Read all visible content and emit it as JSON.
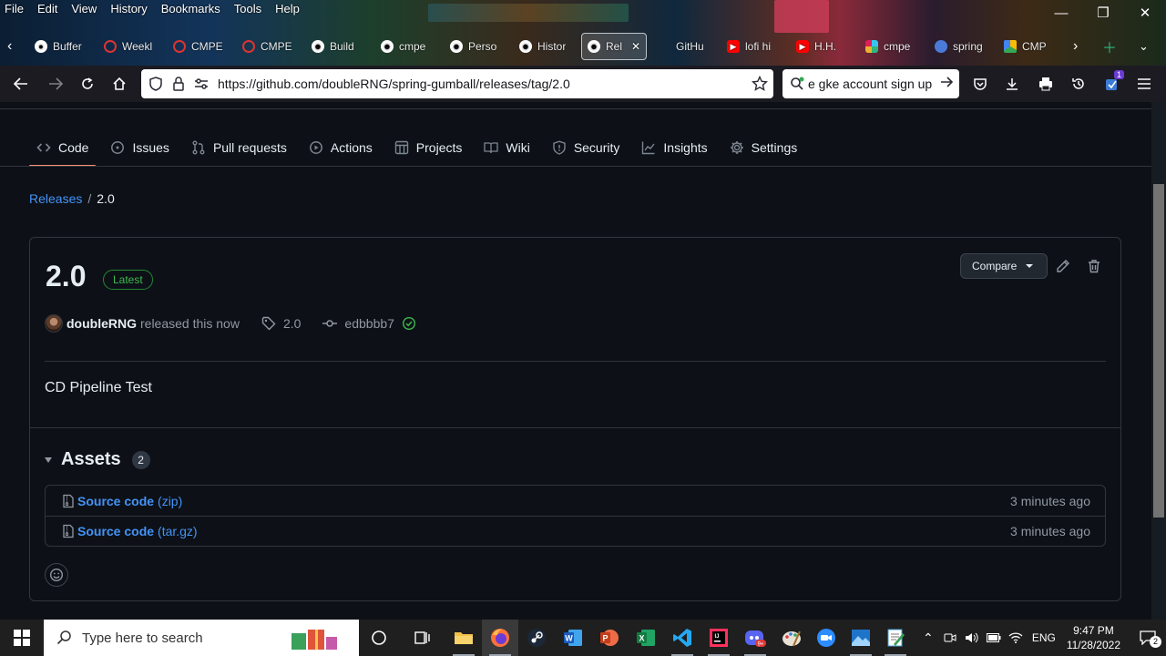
{
  "menu": [
    "File",
    "Edit",
    "View",
    "History",
    "Bookmarks",
    "Tools",
    "Help"
  ],
  "window_controls": [
    "minimize",
    "restore",
    "close"
  ],
  "tabs": [
    {
      "label": "Buffer",
      "icon": "bullet-icon"
    },
    {
      "label": "Weekl",
      "icon": "cmpe-icon"
    },
    {
      "label": "CMPE",
      "icon": "cmpe-icon"
    },
    {
      "label": "CMPE",
      "icon": "cmpe-icon"
    },
    {
      "label": "Build",
      "icon": "github-icon"
    },
    {
      "label": "cmpe",
      "icon": "github-icon"
    },
    {
      "label": "Perso",
      "icon": "github-icon"
    },
    {
      "label": "Histor",
      "icon": "github-icon"
    },
    {
      "label": "Rel",
      "icon": "github-icon"
    },
    {
      "label": "GitHu",
      "icon": "github-icon"
    },
    {
      "label": "lofi hi",
      "icon": "youtube-icon"
    },
    {
      "label": "H.H.",
      "icon": "youtube-icon"
    },
    {
      "label": "cmpe",
      "icon": "slack-icon"
    },
    {
      "label": "spring",
      "icon": "gcp-icon"
    },
    {
      "label": "CMP",
      "icon": "drive-icon"
    }
  ],
  "urlbar": {
    "url": "https://github.com/doubleRNG/spring-gumball/releases/tag/2.0"
  },
  "searchbar": {
    "query": "e gke account sign up"
  },
  "repo_nav": [
    {
      "label": "Code",
      "icon": "code-icon"
    },
    {
      "label": "Issues",
      "icon": "issue-icon"
    },
    {
      "label": "Pull requests",
      "icon": "pull-request-icon"
    },
    {
      "label": "Actions",
      "icon": "play-icon"
    },
    {
      "label": "Projects",
      "icon": "table-icon"
    },
    {
      "label": "Wiki",
      "icon": "book-icon"
    },
    {
      "label": "Security",
      "icon": "shield-icon"
    },
    {
      "label": "Insights",
      "icon": "graph-icon"
    },
    {
      "label": "Settings",
      "icon": "gear-icon"
    }
  ],
  "breadcrumb": {
    "root": "Releases",
    "sep": "/",
    "current": "2.0"
  },
  "release": {
    "title": "2.0",
    "badge": "Latest",
    "compare_label": "Compare",
    "author": "doubleRNG",
    "released_text": "released this now",
    "tag": "2.0",
    "commit": "edbbbb7",
    "notes": "CD Pipeline Test"
  },
  "assets": {
    "title": "Assets",
    "count": "2",
    "items": [
      {
        "name": "Source code",
        "format": "(zip)",
        "time": "3 minutes ago"
      },
      {
        "name": "Source code",
        "format": "(tar.gz)",
        "time": "3 minutes ago"
      }
    ]
  },
  "taskbar": {
    "search_placeholder": "Type here to search",
    "lang": "ENG",
    "time": "9:47 PM",
    "date": "11/28/2022",
    "notif_count": "2",
    "ext_badge": "1"
  },
  "colors": {
    "accent_link": "#4493f8",
    "latest_green": "#3fb950",
    "tab_underline": "#fd8c73"
  }
}
